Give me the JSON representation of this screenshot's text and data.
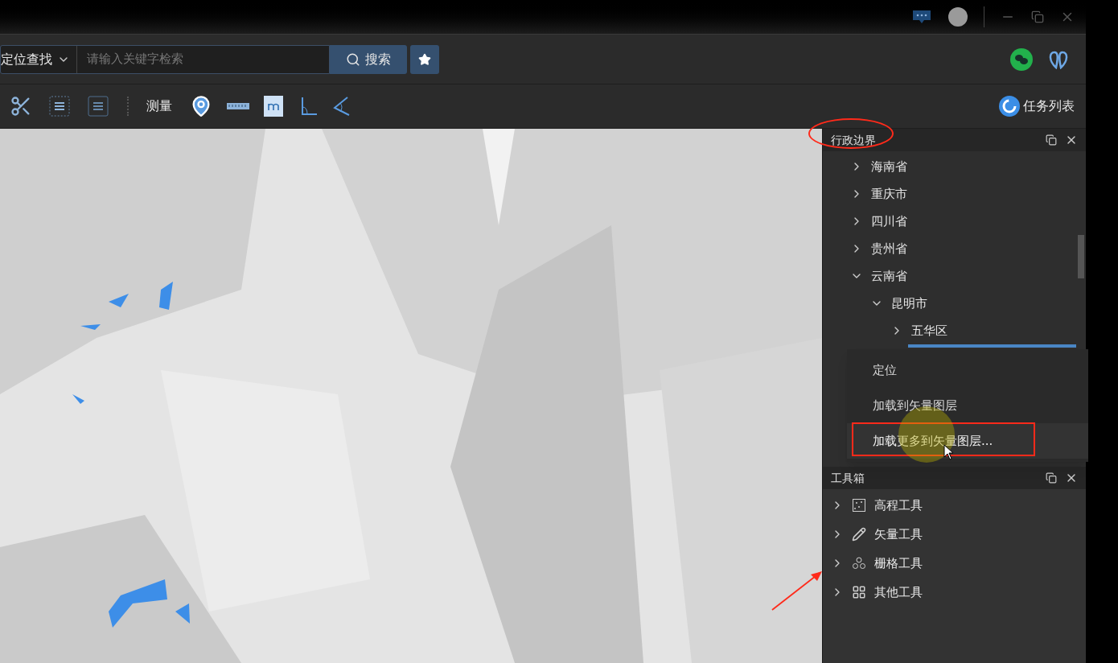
{
  "search": {
    "mode": "定位查找",
    "placeholder": "请输入关键字检索",
    "button": "搜索"
  },
  "toolbar": {
    "measure_label": "测量",
    "task_button": "任务列表"
  },
  "boundary_panel": {
    "title": "行政边界",
    "tree": [
      {
        "label": "海南省",
        "expanded": false
      },
      {
        "label": "重庆市",
        "expanded": false
      },
      {
        "label": "四川省",
        "expanded": false
      },
      {
        "label": "贵州省",
        "expanded": false
      },
      {
        "label": "云南省",
        "expanded": true,
        "children": [
          {
            "label": "昆明市",
            "expanded": true,
            "children": [
              {
                "label": "五华区",
                "expanded": false
              }
            ]
          }
        ]
      }
    ]
  },
  "context_menu": [
    {
      "label": "定位",
      "highlighted": false
    },
    {
      "label": "加载到矢量图层",
      "highlighted": false
    },
    {
      "label": "加载更多到矢量图层...",
      "highlighted": true
    }
  ],
  "toolbox_panel": {
    "title": "工具箱",
    "items": [
      {
        "label": "高程工具",
        "kind": "elevation"
      },
      {
        "label": "矢量工具",
        "kind": "vector"
      },
      {
        "label": "栅格工具",
        "kind": "raster"
      },
      {
        "label": "其他工具",
        "kind": "other"
      }
    ]
  }
}
